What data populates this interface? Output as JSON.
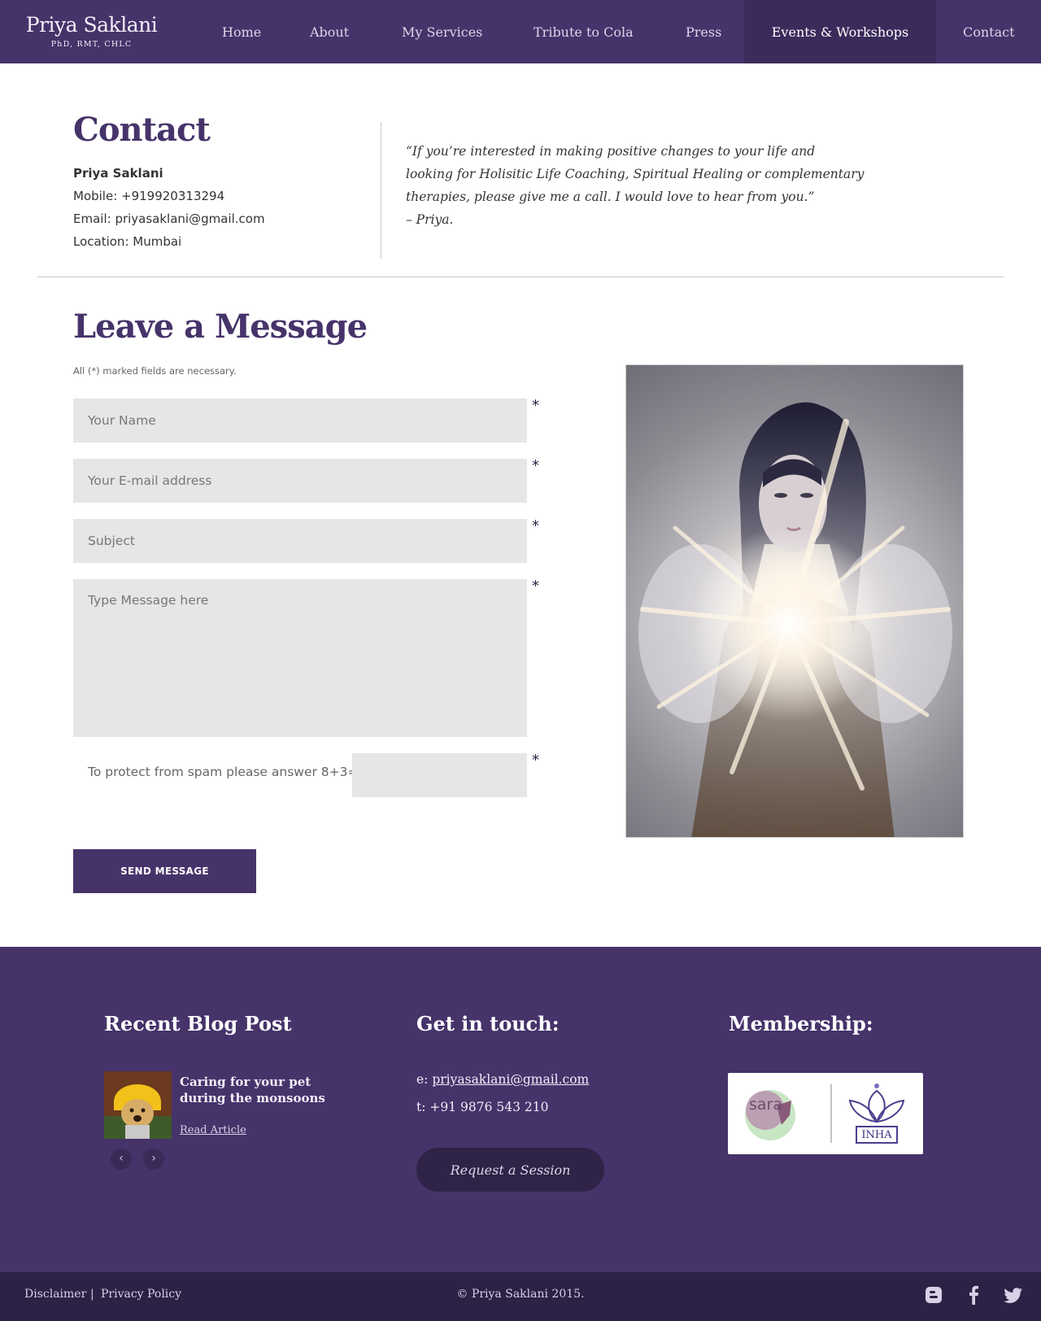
{
  "header": {
    "brand_name": "Priya Saklani",
    "brand_sub": "PhD, RMT, CHLC",
    "nav": [
      "Home",
      "About",
      "My Services",
      "Tribute to Cola",
      "Press",
      "Events & Workshops",
      "Contact"
    ],
    "active_nav": "Events & Workshops"
  },
  "contact": {
    "title": "Contact",
    "name": "Priya Saklani",
    "mobile": "Mobile: +919920313294",
    "email": "Email: priyasaklani@gmail.com",
    "location": "Location: Mumbai",
    "quote_lines": [
      "“If you’re interested in making positive changes to your life and",
      "looking for Holisitic Life Coaching, Spiritual Healing  or complementary",
      "therapies, please give me a call. I would love to hear from you.”",
      "– Priya."
    ]
  },
  "form": {
    "title": "Leave a Message",
    "note": "All (*) marked fields are necessary.",
    "name_placeholder": "Your Name",
    "email_placeholder": "Your E-mail address",
    "subject_placeholder": "Subject",
    "message_placeholder": "Type Message here",
    "spam_question": "To protect from spam please answer 8+3=?",
    "required_mark": "*",
    "send_label": "SEND MESSAGE"
  },
  "footer": {
    "blog_heading": "Recent Blog Post",
    "blog_title": "Caring for your pet during the monsoons",
    "read_article": "Read Article",
    "prev_icon": "‹",
    "next_icon": "›",
    "touch_heading": "Get in touch:",
    "email_prefix": "e: ",
    "email": "priyasaklani@gmail.com",
    "phone": "t: +91 9876 543 210",
    "request_label": "Request a Session",
    "membership_heading": "Membership:",
    "membership_logos": [
      "sara",
      "INHA"
    ]
  },
  "bottom": {
    "disclaimer": "Disclaimer",
    "separator": "|",
    "privacy": "Privacy Policy",
    "copyright": "© Priya Saklani 2015.",
    "social_icons": [
      "blogger-icon",
      "facebook-icon",
      "twitter-icon"
    ]
  },
  "colors": {
    "brand_purple": "#46336a",
    "dark_purple": "#2d2245",
    "field_gray": "#e6e6e6"
  }
}
